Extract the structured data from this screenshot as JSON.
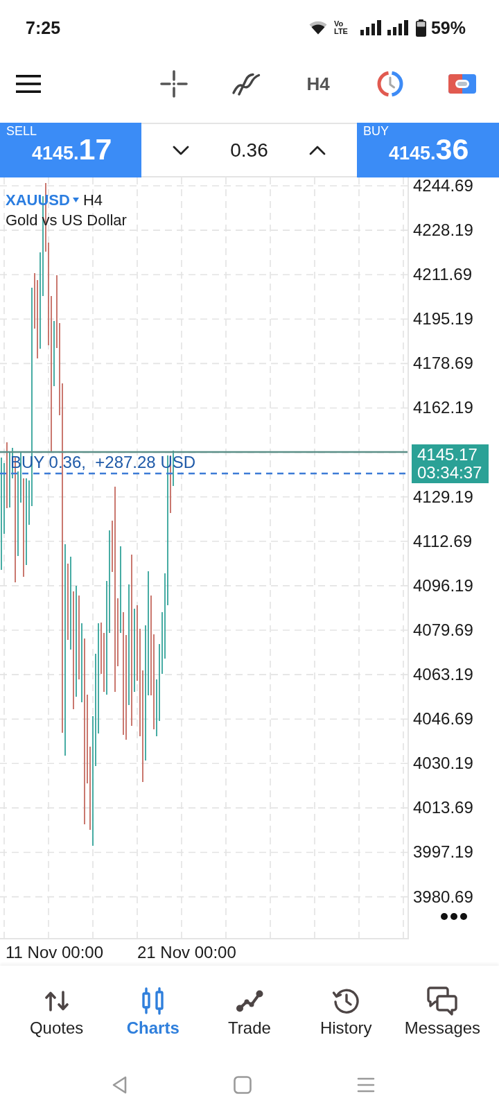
{
  "status_bar": {
    "time": "7:25",
    "network_badge": {
      "top": "Vo",
      "bottom": "LTE"
    },
    "battery_percent": "59%"
  },
  "toolbar": {
    "timeframe": "H4"
  },
  "trade_panel": {
    "sell": {
      "label": "SELL",
      "price_main": "4145.",
      "price_big": "17"
    },
    "volume": "0.36",
    "buy": {
      "label": "BUY",
      "price_main": "4145.",
      "price_big": "36"
    }
  },
  "chart": {
    "symbol": "XAUUSD",
    "timeframe": "H4",
    "description": "Gold vs US Dollar",
    "position_label": "BUY 0.36,  +287.28 USD",
    "price_axis": [
      {
        "kind": "label",
        "text": "4244.69"
      },
      {
        "kind": "label",
        "text": "4228.19"
      },
      {
        "kind": "label",
        "text": "4211.69"
      },
      {
        "kind": "label",
        "text": "4195.19"
      },
      {
        "kind": "label",
        "text": "4178.69"
      },
      {
        "kind": "label",
        "text": "4162.19"
      },
      {
        "kind": "price_tag",
        "price": "4145.17",
        "countdown": "03:34:37"
      },
      {
        "kind": "label",
        "text": "4129.19"
      },
      {
        "kind": "label",
        "text": "4112.69"
      },
      {
        "kind": "label",
        "text": "4096.19"
      },
      {
        "kind": "label",
        "text": "4079.69"
      },
      {
        "kind": "label",
        "text": "4063.19"
      },
      {
        "kind": "label",
        "text": "4046.69"
      },
      {
        "kind": "label",
        "text": "4030.19"
      },
      {
        "kind": "label",
        "text": "4013.69"
      },
      {
        "kind": "label",
        "text": "3997.19"
      },
      {
        "kind": "label",
        "text": "3980.69"
      }
    ],
    "time_axis": [
      "11 Nov 00:00",
      "21 Nov 00:00"
    ]
  },
  "bottom_nav": [
    {
      "label": "Quotes",
      "selected": false
    },
    {
      "label": "Charts",
      "selected": true
    },
    {
      "label": "Trade",
      "selected": false
    },
    {
      "label": "History",
      "selected": false
    },
    {
      "label": "Messages",
      "selected": false
    }
  ]
}
